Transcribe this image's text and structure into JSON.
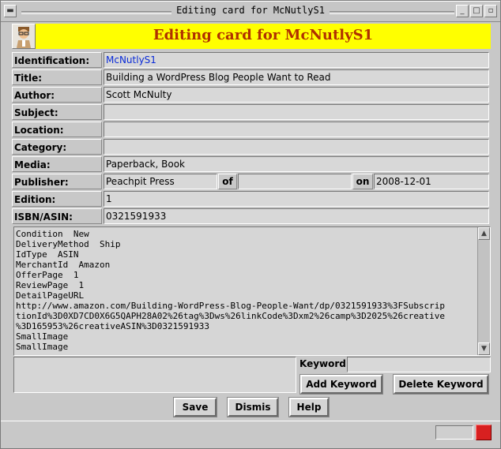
{
  "window": {
    "title": "Editing card for McNutlyS1",
    "minimize_glyph": "_",
    "maximize_glyph": "□",
    "close_glyph": "▫"
  },
  "header": {
    "banner": "Editing card for McNutlyS1",
    "banner_color": "#ffff00",
    "banner_text_color": "#b03000"
  },
  "fields": {
    "identification": {
      "label": "Identification:",
      "value": "McNutlyS1"
    },
    "title": {
      "label": "Title:",
      "value": "Building a WordPress Blog People Want to Read"
    },
    "author": {
      "label": "Author:",
      "value": "Scott McNulty"
    },
    "subject": {
      "label": "Subject:",
      "value": ""
    },
    "location": {
      "label": "Location:",
      "value": ""
    },
    "category": {
      "label": "Category:",
      "value": ""
    },
    "media": {
      "label": "Media:",
      "value": "Paperback, Book"
    },
    "publisher": {
      "label": "Publisher:",
      "value": "Peachpit Press",
      "of_label": "of",
      "of_value": "",
      "on_label": "on",
      "on_value": "2008-12-01"
    },
    "edition": {
      "label": "Edition:",
      "value": "1"
    },
    "isbn": {
      "label": "ISBN/ASIN:",
      "value": "0321591933"
    }
  },
  "notes": {
    "text": "Condition  New\nDeliveryMethod  Ship\nIdType  ASIN\nMerchantId  Amazon\nOfferPage  1\nReviewPage  1\nDetailPageURL\nhttp://www.amazon.com/Building-WordPress-Blog-People-Want/dp/0321591933%3FSubscrip\ntionId%3D0XD7CD0X6G5QAPH28A02%26tag%3Dws%26linkCode%3Dxm2%26camp%3D2025%26creative\n%3D165953%26creativeASIN%3D0321591933\nSmallImage\nSmallImage"
  },
  "keywords": {
    "label": "Keyword:",
    "value": "",
    "add_label": "Add Keyword",
    "delete_label": "Delete Keyword"
  },
  "actions": {
    "save_label": "Save",
    "dismiss_label": "Dismis",
    "help_label": "Help"
  },
  "status": {
    "indicator_color": "#d82020"
  }
}
